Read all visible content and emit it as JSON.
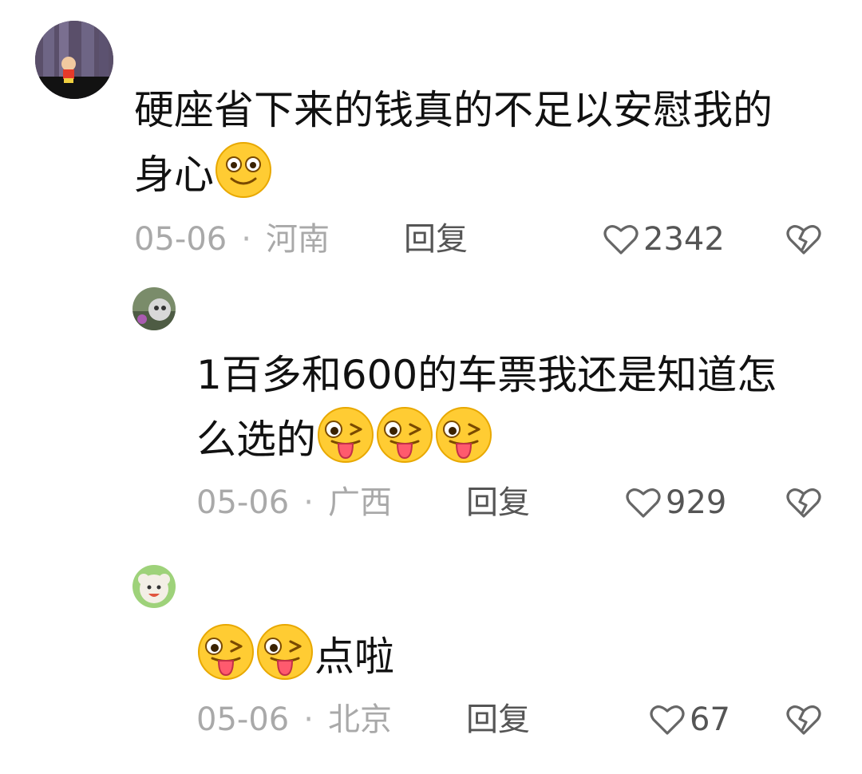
{
  "comments": [
    {
      "text_line1": "硬座省下来的钱真的不足以安慰我的",
      "text_line2": "身心",
      "emojis": [
        "smile-emoji"
      ],
      "date": "05-06",
      "sep": "·",
      "location": "河南",
      "reply_label": "回复",
      "likes": "2342"
    },
    {
      "text_line1": "1百多和600的车票我还是知道怎",
      "text_line2": "么选的",
      "emojis": [
        "tongue-wink-emoji",
        "tongue-wink-emoji",
        "tongue-wink-emoji"
      ],
      "date": "05-06",
      "sep": "·",
      "location": "广西",
      "reply_label": "回复",
      "likes": "929"
    },
    {
      "text_line1": "点啦",
      "emojis": [
        "tongue-wink-emoji",
        "tongue-wink-emoji"
      ],
      "date": "05-06",
      "sep": "·",
      "location": "北京",
      "reply_label": "回复",
      "likes": "67"
    }
  ],
  "colors": {
    "text": "#111111",
    "meta": "#a9a9a9",
    "action": "#555555",
    "emoji_face": "#ffcc33",
    "tongue": "#ff5a6e"
  }
}
